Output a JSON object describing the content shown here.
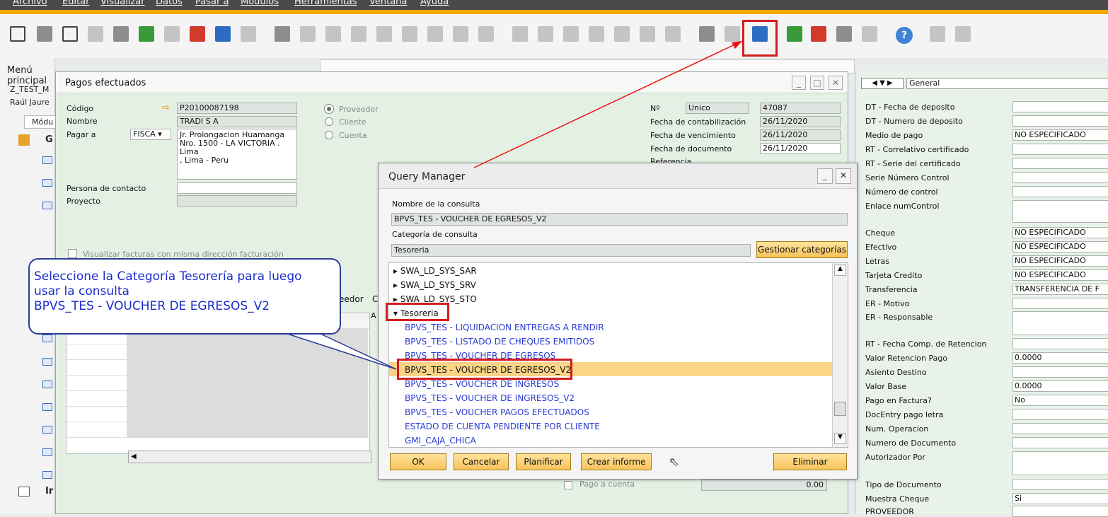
{
  "menu": [
    "Archivo",
    "Editar",
    "Visualizar",
    "Datos",
    "Pasar a",
    "Módulos",
    "Herramientas",
    "Ventana",
    "Ayuda"
  ],
  "left": {
    "menu_title": "Menú principal",
    "company": "Z_TEST_M",
    "user": "Raúl Jaure",
    "tab": "Módu",
    "items": [
      "G",
      "Ir"
    ]
  },
  "pagos": {
    "title": "Pagos efectuados",
    "codigo_label": "Código",
    "codigo": "P20100087198",
    "nombre_label": "Nombre",
    "nombre": "TRADI S A",
    "pagar_label": "Pagar a",
    "pagar_sel": "FISCA",
    "address": [
      "Jr. Prolongacion Huamanga",
      "Nro. 1500 - LA VICTORIA .",
      "Lima",
      ", Lima - Peru"
    ],
    "contacto_label": "Persona de contacto",
    "proyecto_label": "Proyecto",
    "radio": [
      "Proveedor",
      "Cliente",
      "Cuenta"
    ],
    "checkbox": "Visualizar facturas con misma dirección facturación",
    "grid_col": "eedor",
    "grid_col2": "C",
    "grid_cell": "A",
    "no_label": "Nº",
    "no_series": "Unico",
    "no_value": "47087",
    "dates": [
      {
        "label": "Fecha de contabilización",
        "value": "26/11/2020"
      },
      {
        "label": "Fecha de vencimiento",
        "value": "26/11/2020"
      },
      {
        "label": "Fecha de documento",
        "value": "26/11/2020"
      }
    ],
    "ref_label": "Referencia",
    "pago_cuenta": "Pago a cuenta",
    "pago_cuenta_val": "0.00"
  },
  "right": {
    "nav": "General",
    "fields": [
      {
        "l": "DT - Fecha de deposito",
        "v": ""
      },
      {
        "l": "DT - Numero de deposito",
        "v": ""
      },
      {
        "l": "Medio de pago",
        "v": "NO ESPECIFICADO"
      },
      {
        "l": "RT - Correlativo certificado",
        "v": ""
      },
      {
        "l": "RT - Serie del certificado",
        "v": ""
      },
      {
        "l": "Serie Número Control",
        "v": ""
      },
      {
        "l": "Número de control",
        "v": ""
      },
      {
        "l": "Enlace numControl",
        "v": ""
      },
      {
        "l": "Cheque",
        "v": "NO ESPECIFICADO"
      },
      {
        "l": "Efectivo",
        "v": "NO ESPECIFICADO"
      },
      {
        "l": "Letras",
        "v": "NO ESPECIFICADO"
      },
      {
        "l": "Tarjeta Credito",
        "v": "NO ESPECIFICADO"
      },
      {
        "l": "Transferencia",
        "v": "TRANSFERENCIA DE F"
      },
      {
        "l": "ER - Motivo",
        "v": ""
      },
      {
        "l": "ER - Responsable",
        "v": ""
      },
      {
        "l": "RT - Fecha Comp. de Retencion",
        "v": ""
      },
      {
        "l": "Valor Retencion Pago",
        "v": "0.0000"
      },
      {
        "l": "Asiento Destino",
        "v": ""
      },
      {
        "l": "Valor Base",
        "v": "0.0000"
      },
      {
        "l": "Pago en Factura?",
        "v": "No"
      },
      {
        "l": "DocEntry pago letra",
        "v": ""
      },
      {
        "l": "Num. Operacion",
        "v": ""
      },
      {
        "l": "Numero de Documento",
        "v": ""
      },
      {
        "l": "Autorizador Por",
        "v": ""
      },
      {
        "l": "Tipo de Documento",
        "v": ""
      },
      {
        "l": "Muestra Cheque",
        "v": "Si"
      },
      {
        "l": "PROVEEDOR",
        "v": ""
      }
    ]
  },
  "qm": {
    "title": "Query Manager",
    "name_label": "Nombre de la consulta",
    "name_value": "BPVS_TES - VOUCHER DE EGRESOS_V2",
    "cat_label": "Categoría de consulta",
    "cat_value": "Tesoreria",
    "manage_btn": "Gestionar categorías",
    "tree": [
      "SWA_LD_SYS_SAR",
      "SWA_LD_SYS_SRV",
      "SWA_LD_SYS_STO",
      "Tesoreria"
    ],
    "queries": [
      "BPVS_TES - LIQUIDACION ENTREGAS A RENDIR",
      "BPVS_TES - LISTADO DE CHEQUES EMITIDOS",
      "BPVS_TES - VOUCHER DE EGRESOS",
      "BPVS_TES - VOUCHER DE EGRESOS_V2",
      "BPVS_TES - VOUCHER DE INGRESOS",
      "BPVS_TES - VOUCHER DE INGRESOS_V2",
      "BPVS_TES - VOUCHER PAGOS EFECTUADOS",
      "ESTADO DE CUENTA PENDIENTE POR CLIENTE",
      "GMI_CAJA_CHICA"
    ],
    "buttons": {
      "ok": "OK",
      "cancel": "Cancelar",
      "plan": "Planificar",
      "report": "Crear informe",
      "delete": "Eliminar"
    }
  },
  "callout": [
    "Seleccione la Categoría Tesorería para luego",
    "usar la consulta",
    "BPVS_TES - VOUCHER DE EGRESOS_V2"
  ]
}
